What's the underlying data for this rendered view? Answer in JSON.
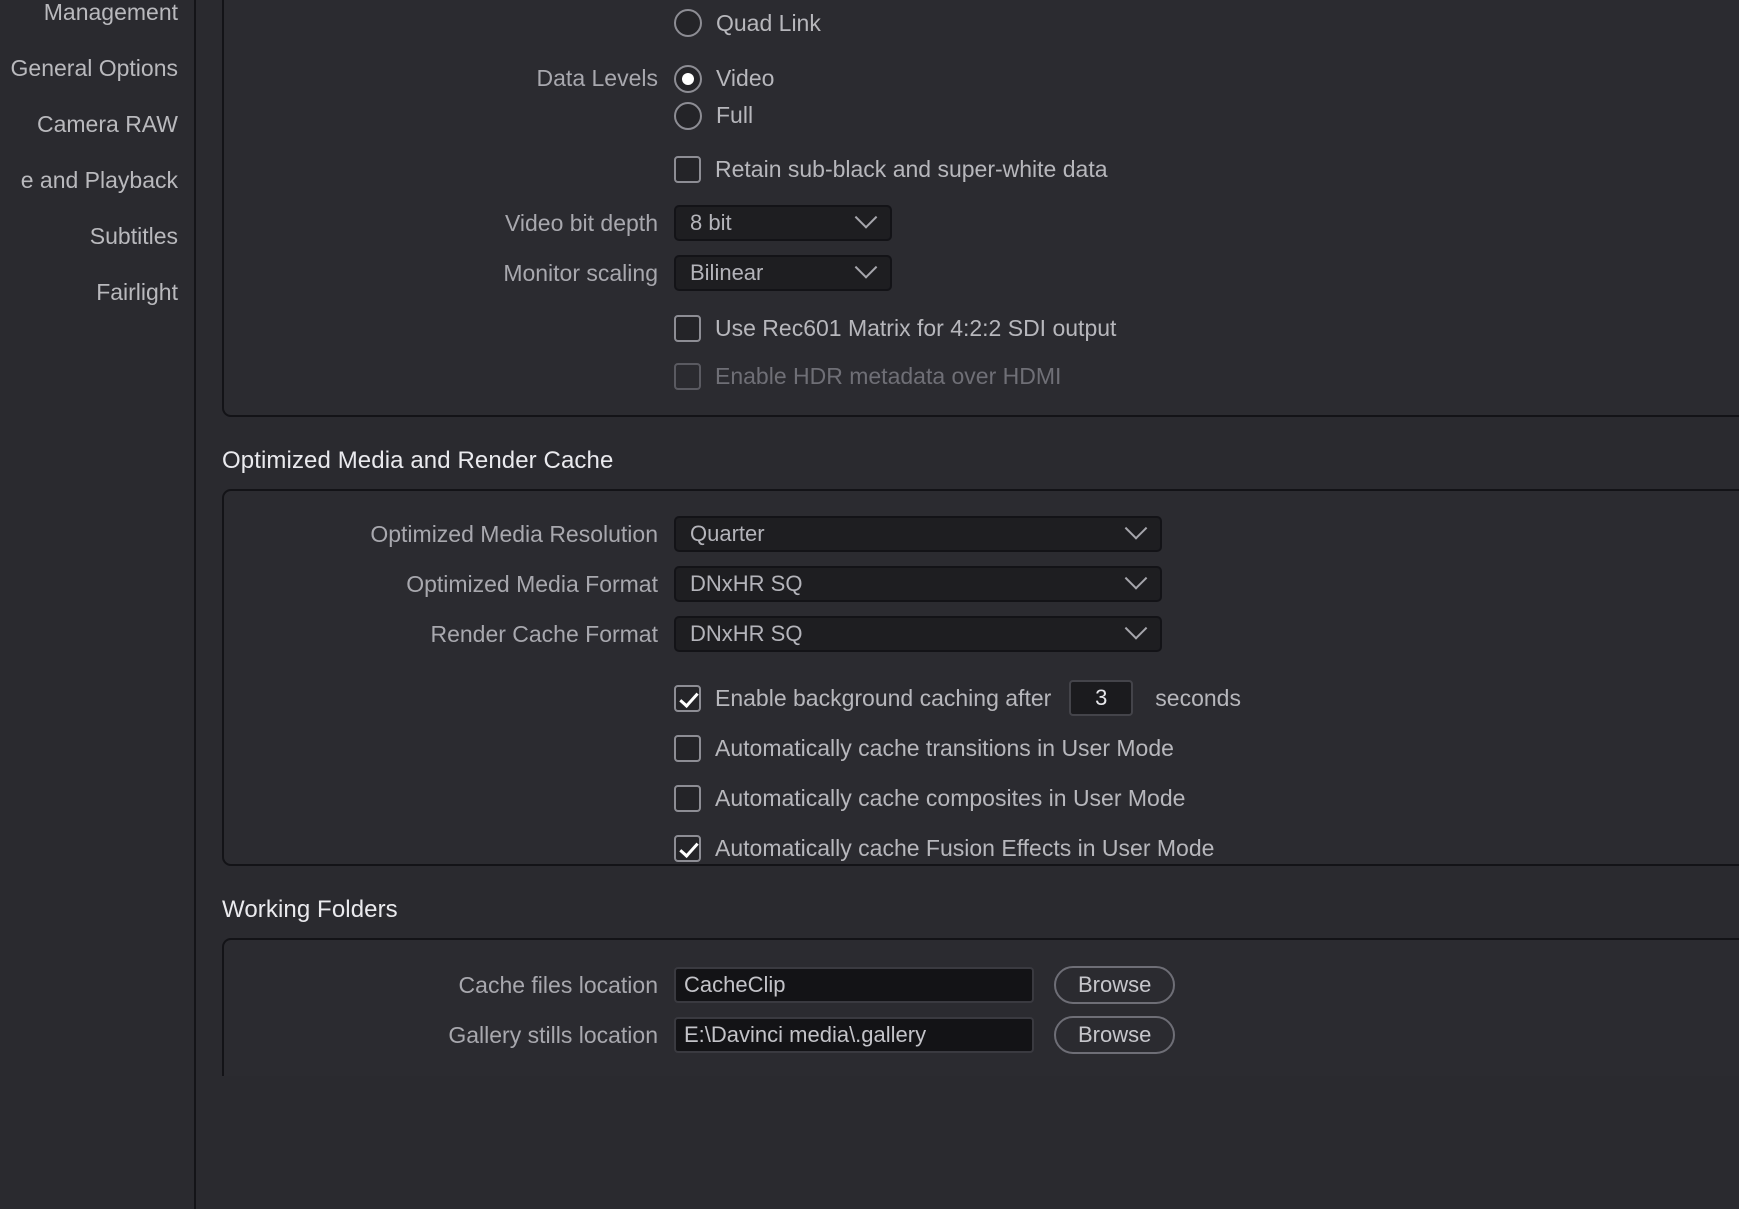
{
  "sidebar": {
    "items": [
      {
        "label": "Management"
      },
      {
        "label": "General Options"
      },
      {
        "label": "Camera RAW"
      },
      {
        "label": "e and Playback"
      },
      {
        "label": "Subtitles"
      },
      {
        "label": "Fairlight"
      }
    ]
  },
  "master_settings": {
    "sdi_link": {
      "quad_link_label": "Quad Link",
      "quad_link_checked": false
    },
    "data_levels": {
      "label": "Data Levels",
      "options": [
        {
          "label": "Video",
          "selected": true
        },
        {
          "label": "Full",
          "selected": false
        }
      ]
    },
    "retain_subblack": {
      "label": "Retain sub-black and super-white data",
      "checked": false
    },
    "video_bit_depth": {
      "label": "Video bit depth",
      "value": "8 bit"
    },
    "monitor_scaling": {
      "label": "Monitor scaling",
      "value": "Bilinear"
    },
    "rec601_matrix": {
      "label": "Use Rec601 Matrix for 4:2:2 SDI output",
      "checked": false
    },
    "hdr_metadata": {
      "label": "Enable HDR metadata over HDMI",
      "checked": false,
      "disabled": true
    }
  },
  "optimized_media": {
    "heading": "Optimized Media and Render Cache",
    "resolution": {
      "label": "Optimized Media Resolution",
      "value": "Quarter"
    },
    "media_format": {
      "label": "Optimized Media Format",
      "value": "DNxHR SQ"
    },
    "cache_format": {
      "label": "Render Cache Format",
      "value": "DNxHR SQ"
    },
    "background_caching": {
      "label": "Enable background caching after",
      "checked": true,
      "seconds_value": "3",
      "unit": "seconds"
    },
    "cache_transitions": {
      "label": "Automatically cache transitions in User Mode",
      "checked": false
    },
    "cache_composites": {
      "label": "Automatically cache composites in User Mode",
      "checked": false
    },
    "cache_fusion": {
      "label": "Automatically cache Fusion Effects in User Mode",
      "checked": true
    }
  },
  "working_folders": {
    "heading": "Working Folders",
    "cache_files": {
      "label": "Cache files location",
      "value": "CacheClip",
      "browse_label": "Browse"
    },
    "gallery_stills": {
      "label": "Gallery stills location",
      "value": "E:\\Davinci media\\.gallery",
      "browse_label": "Browse"
    }
  },
  "colors": {
    "background": "#2a2a2f",
    "panel_border": "#131317",
    "text_primary": "#eaeaee",
    "text_secondary": "#b7b7bc",
    "text_label": "#a8a8ae",
    "text_disabled": "#6f6f76",
    "input_bg": "#131316",
    "dropdown_bg": "#1e1e21"
  }
}
